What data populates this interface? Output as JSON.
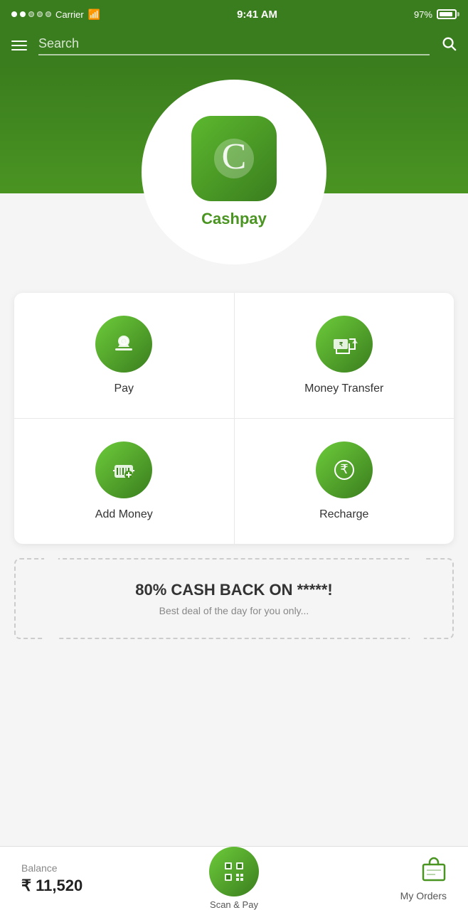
{
  "status": {
    "carrier": "Carrier",
    "time": "9:41 AM",
    "battery_pct": "97%"
  },
  "search": {
    "placeholder": "Search"
  },
  "hero": {
    "app_name": "Cashpay"
  },
  "grid": {
    "items": [
      {
        "id": "pay",
        "label": "Pay",
        "icon": "💸"
      },
      {
        "id": "money-transfer",
        "label": "Money Transfer",
        "icon": "🏦"
      },
      {
        "id": "add-money",
        "label": "Add Money",
        "icon": "👜"
      },
      {
        "id": "recharge",
        "label": "Recharge",
        "icon": "₹"
      }
    ]
  },
  "banner": {
    "title": "80% CASH BACK ON *****!",
    "subtitle": "Best deal of the day for you only..."
  },
  "bottom": {
    "balance_label": "Balance",
    "balance_amount": "₹ 11,520",
    "scan_label": "Scan & Pay",
    "orders_label": "My Orders"
  }
}
